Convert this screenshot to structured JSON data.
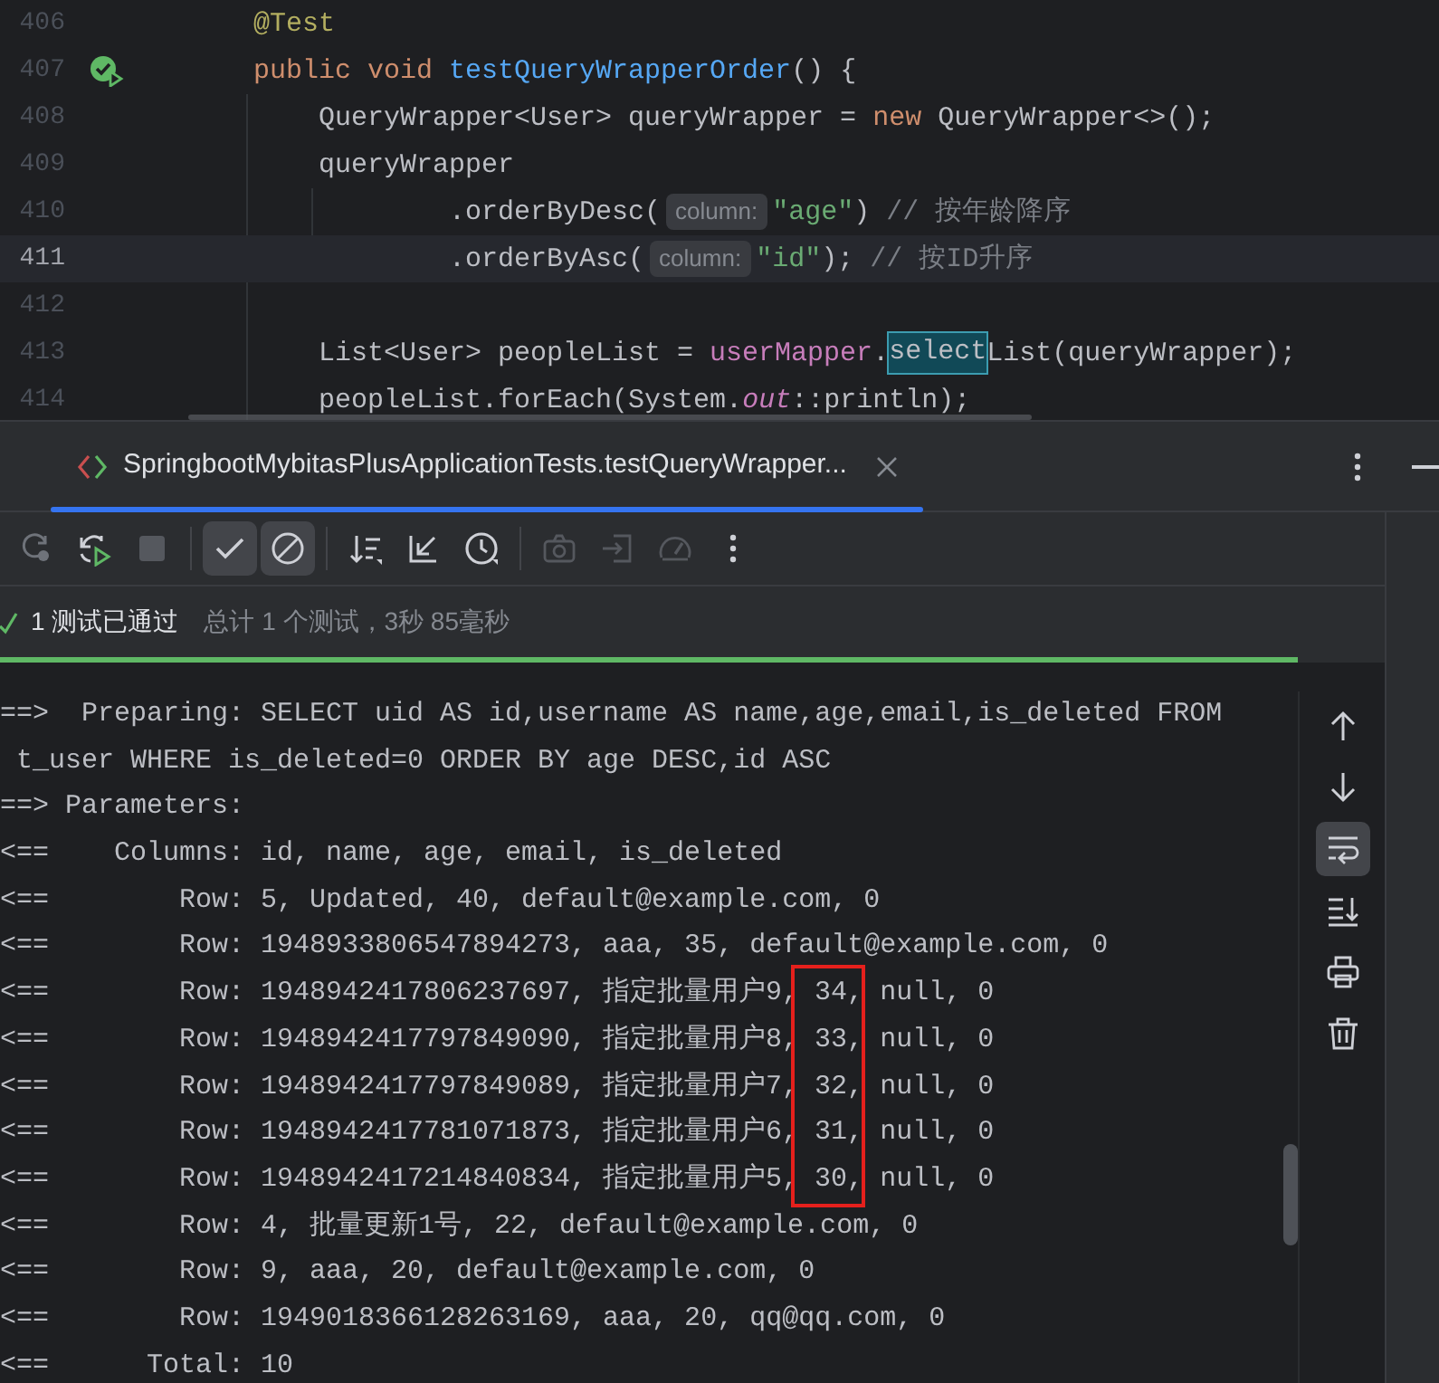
{
  "editor": {
    "lines": [
      {
        "number": "406",
        "current": false,
        "tokens": [
          {
            "kind": "annotation",
            "text": "    @Test"
          }
        ]
      },
      {
        "number": "407",
        "current": false,
        "run_marker": true,
        "tokens": [
          {
            "kind": "keyword",
            "text": "    public void "
          },
          {
            "kind": "declaration",
            "text": "testQueryWrapperOrder"
          },
          {
            "kind": "plain",
            "text": "() {"
          }
        ]
      },
      {
        "number": "408",
        "current": false,
        "tokens": [
          {
            "kind": "plain",
            "text": "        QueryWrapper<User> queryWrapper = "
          },
          {
            "kind": "keyword",
            "text": "new"
          },
          {
            "kind": "plain",
            "text": " QueryWrapper<>();"
          }
        ]
      },
      {
        "number": "409",
        "current": false,
        "tokens": [
          {
            "kind": "plain",
            "text": "        queryWrapper"
          }
        ]
      },
      {
        "number": "410",
        "current": false,
        "tokens": [
          {
            "kind": "plain",
            "text": "                .orderByDesc("
          },
          {
            "kind": "hint",
            "text": "column:"
          },
          {
            "kind": "string",
            "text": "\"age\""
          },
          {
            "kind": "plain",
            "text": ") "
          },
          {
            "kind": "comment",
            "text": "// 按年龄降序"
          }
        ]
      },
      {
        "number": "411",
        "current": true,
        "tokens": [
          {
            "kind": "plain",
            "text": "                .orderByAsc("
          },
          {
            "kind": "hint",
            "text": "column:"
          },
          {
            "kind": "string",
            "text": "\"id\""
          },
          {
            "kind": "plain",
            "text": "); "
          },
          {
            "kind": "comment",
            "text": "// 按ID升序"
          }
        ]
      },
      {
        "number": "412",
        "current": false
      },
      {
        "number": "413",
        "current": false,
        "tokens": [
          {
            "kind": "plain",
            "text": "        List<User> peopleList = "
          },
          {
            "kind": "field",
            "text": "userMapper"
          },
          {
            "kind": "plain",
            "text": "."
          },
          {
            "kind": "match",
            "text": "select"
          },
          {
            "kind": "plain",
            "text": "List(queryWrapper);"
          }
        ]
      },
      {
        "number": "414",
        "current": false,
        "tokens": [
          {
            "kind": "plain",
            "text": "        peopleList.forEach(System."
          },
          {
            "kind": "static_field",
            "text": "out"
          },
          {
            "kind": "plain",
            "text": "::println);"
          }
        ]
      }
    ]
  },
  "run_panel": {
    "tabs": [
      {
        "label": "SpringbootMybitasPlusApplicationTests.testQueryWrapper...",
        "selected": true
      }
    ],
    "toolbar": [
      {
        "tools": [
          {
            "kind": "rerun",
            "on": false,
            "disabled": true
          },
          {
            "kind": "rerun_play",
            "on": false,
            "disabled": false
          },
          {
            "kind": "stop",
            "on": false,
            "disabled": true
          }
        ]
      },
      {
        "tools": [
          {
            "kind": "check",
            "on": true,
            "disabled": false
          },
          {
            "kind": "ban",
            "on": true,
            "disabled": false
          }
        ]
      },
      {
        "tools": [
          {
            "kind": "sort",
            "on": false,
            "disabled": false
          },
          {
            "kind": "corner_arrow",
            "on": false,
            "disabled": false
          },
          {
            "kind": "clock",
            "on": false,
            "disabled": false
          }
        ]
      },
      {
        "tools": [
          {
            "kind": "camera",
            "on": false,
            "disabled": true
          },
          {
            "kind": "enter",
            "on": false,
            "disabled": true
          },
          {
            "kind": "gauge",
            "on": false,
            "disabled": true
          },
          {
            "kind": "more",
            "on": false,
            "disabled": false
          }
        ]
      }
    ],
    "status": {
      "passed": "1 测试已通过",
      "summary": "总计 1 个测试，3秒 85毫秒",
      "level": 1
    },
    "console": {
      "lines": [
        "==>  Preparing: SELECT uid AS id,username AS name,age,email,is_deleted FROM",
        " t_user WHERE is_deleted=0 ORDER BY age DESC,id ASC",
        "==> Parameters: ",
        "<==    Columns: id, name, age, email, is_deleted",
        "<==        Row: 5, Updated, 40, default@example.com, 0",
        "<==        Row: 1948933806547894273, aaa, 35, default@example.com, 0",
        "<==        Row: 1948942417806237697, 指定批量用户9, 34, null, 0",
        "<==        Row: 1948942417797849090, 指定批量用户8, 33, null, 0",
        "<==        Row: 1948942417797849089, 指定批量用户7, 32, null, 0",
        "<==        Row: 1948942417781071873, 指定批量用户6, 31, null, 0",
        "<==        Row: 1948942417214840834, 指定批量用户5, 30, null, 0",
        "<==        Row: 4, 批量更新1号, 22, default@example.com, 0",
        "<==        Row: 9, aaa, 20, default@example.com, 0",
        "<==        Row: 1949018366128263169, aaa, 20, qq@qq.com, 0",
        "<==      Total: 10"
      ],
      "side_tools": [
        {
          "kind": "up",
          "on": false
        },
        {
          "kind": "down",
          "on": false
        },
        {
          "kind": "wrap",
          "on": true
        },
        {
          "kind": "scroll_end",
          "on": false
        },
        {
          "kind": "print",
          "on": false
        },
        {
          "kind": "delete",
          "on": false
        }
      ]
    }
  }
}
